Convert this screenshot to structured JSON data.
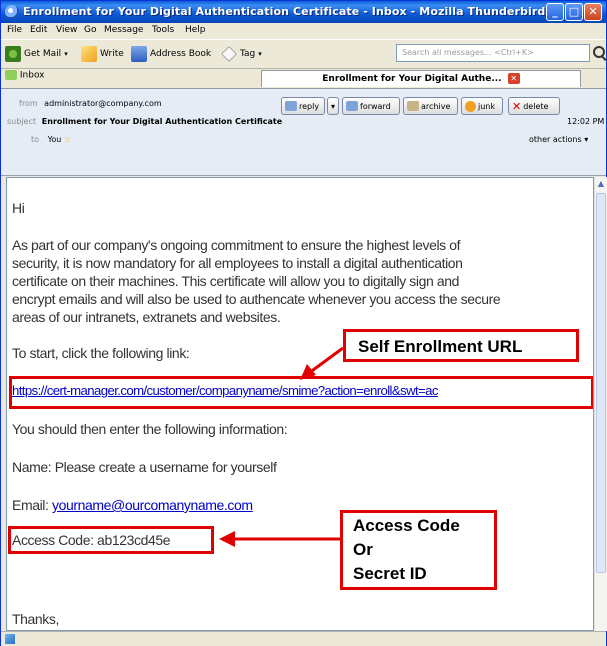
{
  "window": {
    "title": "Enrollment for Your Digital Authentication Certificate - Inbox - Mozilla Thunderbird"
  },
  "menu": {
    "items": [
      "File",
      "Edit",
      "View",
      "Go",
      "Message",
      "Tools",
      "Help"
    ]
  },
  "toolbar": {
    "get_mail": "Get Mail",
    "write": "Write",
    "address_book": "Address Book",
    "tag": "Tag",
    "search_placeholder": "Search all messages... <Ctrl+K>"
  },
  "tabs": {
    "inbox": "Inbox",
    "message": "Enrollment for Your Digital Authe..."
  },
  "header": {
    "from_label": "from",
    "from_value": "administrator@company.com",
    "subject_label": "subject",
    "subject_value": "Enrollment for Your Digital Authentication Certificate",
    "to_label": "to",
    "to_value": "You",
    "time": "12:02 PM",
    "other_actions": "other actions",
    "actions": {
      "reply": "reply",
      "forward": "forward",
      "archive": "archive",
      "junk": "junk",
      "delete": "delete"
    }
  },
  "body": {
    "greeting": "Hi",
    "para1": [
      "As part of our company's ongoing commitment to ensure the highest levels of",
      "security, it is now mandatory for all employees to install a digital authentication",
      "certificate on their machines. This certificate will allow you to digitally sign and",
      "encrypt emails and will also be used to authencate whenever you access the secure",
      "areas of our intranets, extranets and websites."
    ],
    "start": "To start, click the following link:",
    "url": "https://cert-manager.com/customer/companyname/smime?action=enroll&swt=ac",
    "then": "You should then enter the following information:",
    "name": "Name: Please create a username for yourself",
    "email_label": "Email:",
    "email_value": "yourname@ourcomanyname.com",
    "access": "Access Code: ab123cd45e",
    "thanks": "Thanks,"
  },
  "annotations": {
    "url_callout": "Self Enrollment URL",
    "code_callout": [
      "Access Code",
      "Or",
      "Secret ID"
    ]
  },
  "colors": {
    "annotation_red": "#e00000",
    "link_blue": "#0000cc",
    "titlebar_blue": "#0a5fd8"
  }
}
